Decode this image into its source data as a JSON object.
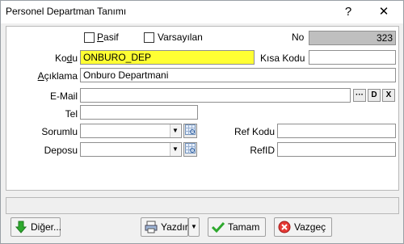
{
  "window": {
    "title": "Personel Departman Tanımı",
    "help_label": "?",
    "close_label": "✕"
  },
  "form": {
    "pasif_label": "Pasif",
    "varsayilan_label": "Varsayılan",
    "no_label": "No",
    "no_value": "323",
    "kodu_label": "Kodu",
    "kodu_value": "ONBURO_DEP",
    "kisa_kodu_label": "Kısa Kodu",
    "kisa_kodu_value": "",
    "aciklama_label": "Açıklama",
    "aciklama_value": "Onburo Departmani",
    "email_label": "E-Mail",
    "email_value": "",
    "email_btn_more": "···",
    "email_btn_d": "D",
    "email_btn_x": "X",
    "tel_label": "Tel",
    "tel_value": "",
    "sorumlu_label": "Sorumlu",
    "sorumlu_value": "",
    "deposu_label": "Deposu",
    "deposu_value": "",
    "ref_kodu_label": "Ref Kodu",
    "ref_kodu_value": "",
    "refid_label": "RefID",
    "refid_value": ""
  },
  "buttons": {
    "diger": "Diğer...",
    "yazdir": "Yazdır",
    "tamam": "Tamam",
    "vazgec": "Vazgeç"
  },
  "colors": {
    "kodu_bg": "#ffff33",
    "no_bg": "#bfbfbf"
  },
  "icons": {
    "diger": "green-down-arrow-icon",
    "yazdir": "printer-icon",
    "tamam": "green-check-icon",
    "vazgec": "red-cancel-icon",
    "lookup": "lookup-grid-icon"
  }
}
